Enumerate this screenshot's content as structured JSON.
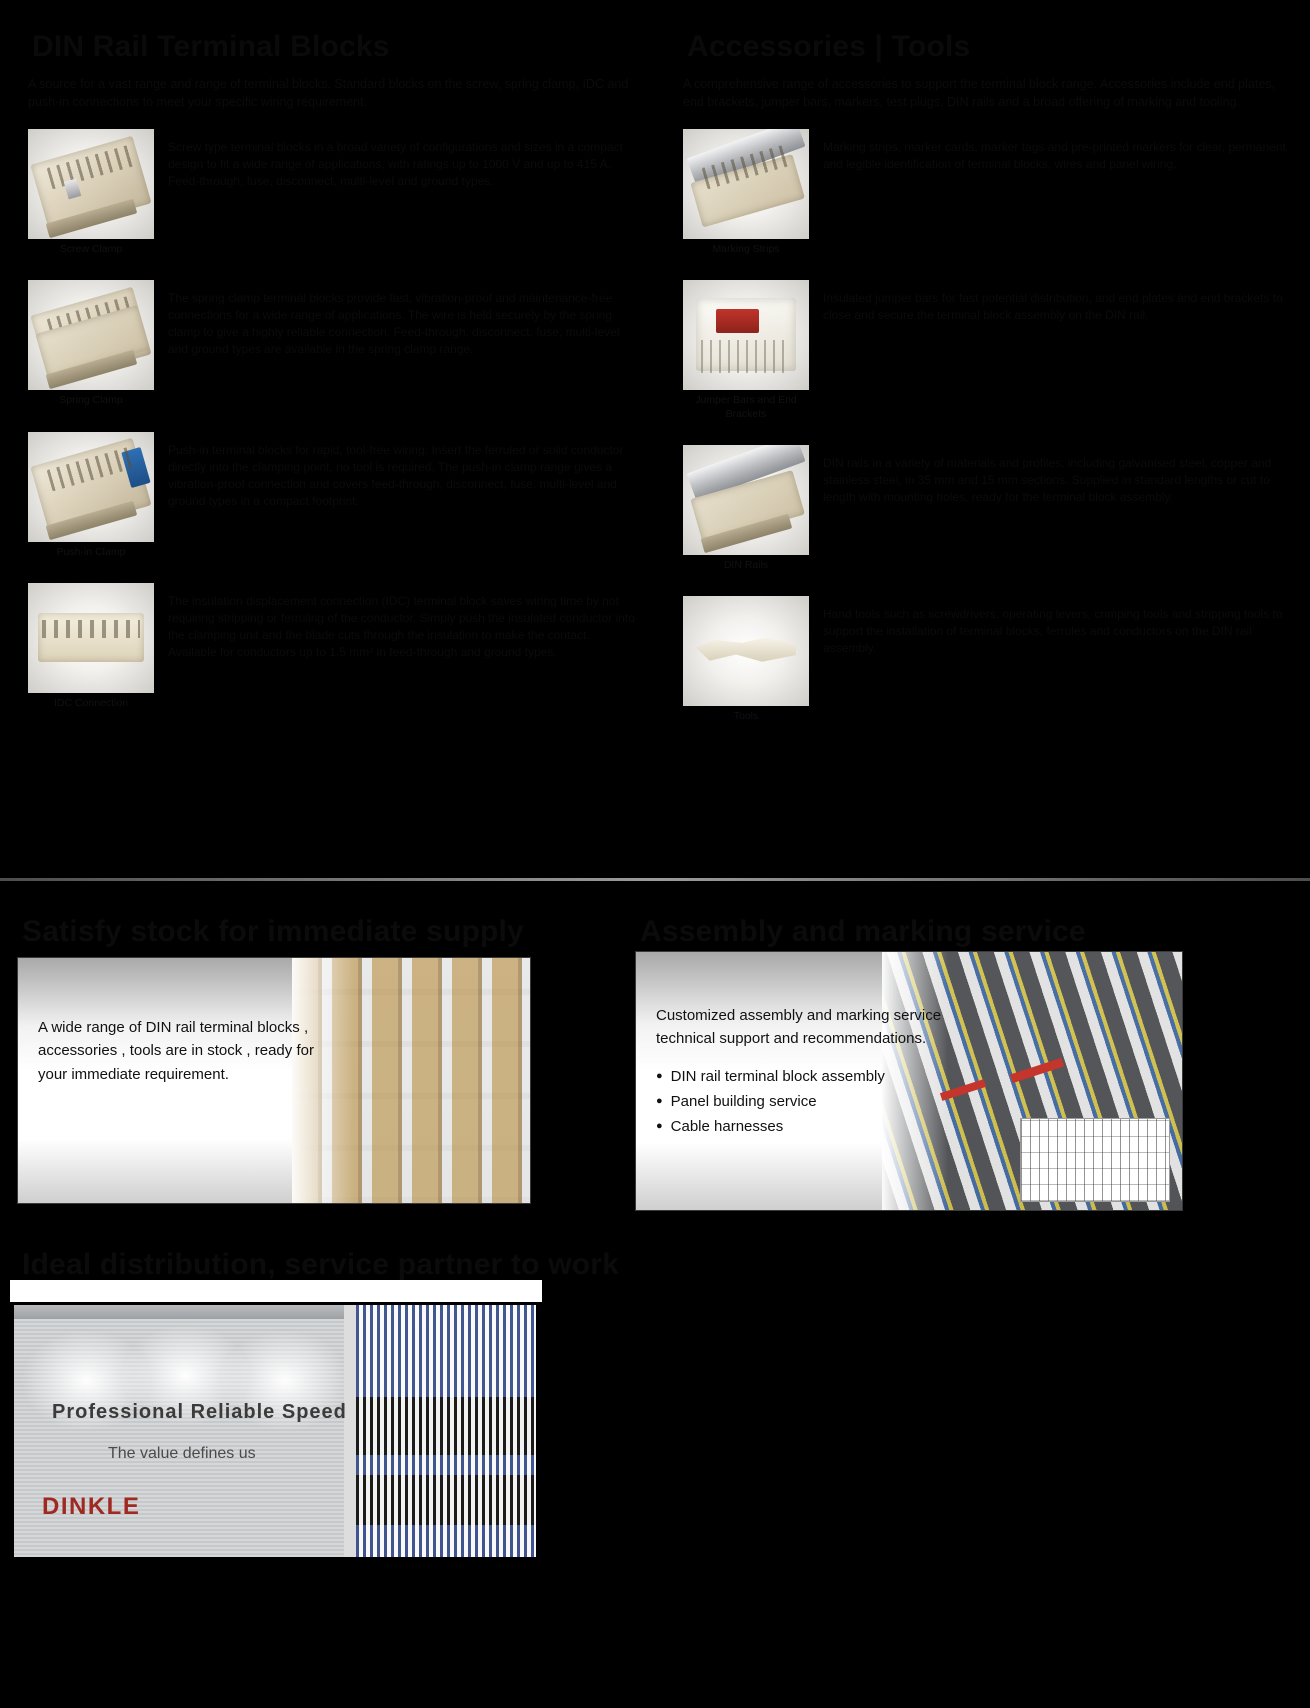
{
  "meta": {
    "background": "#000000",
    "accent_red": "#a02a22"
  },
  "left_column": {
    "heading": "DIN Rail Terminal Blocks",
    "intro": "A source for a vast range and range of terminal blocks. Standard blocks on the screw, spring clamp, IDC and push-in connections to meet your specific wiring requirement.",
    "items": [
      {
        "caption": "Screw Clamp",
        "text": "Screw type terminal blocks in a broad variety of configurations and sizes in a compact design to fit a wide range of applications, with ratings up to 1000 V and up to 415 A. Feed-through, fuse, disconnect, multi-level and ground types.",
        "icon": "terminal-block-screw-clamp"
      },
      {
        "caption": "Spring Clamp",
        "text": "The spring clamp terminal blocks provide fast, vibration-proof and maintenance-free connections for a wide range of applications. The wire is held securely by the spring clamp to give a highly reliable connection. Feed-through, disconnect, fuse, multi-level and ground types are available in the spring clamp range.",
        "icon": "terminal-block-spring-clamp"
      },
      {
        "caption": "Push-in Clamp",
        "text": "Push-in terminal blocks for rapid, tool-free wiring. Insert the ferruled or solid conductor directly into the clamping point, no tool is required. The push-in clamp range gives a vibration-proof connection and covers feed-through, disconnect, fuse, multi-level and ground types in a compact footprint.",
        "icon": "terminal-block-push-in"
      },
      {
        "caption": "IDC Connection",
        "text": "The insulation displacement connection (IDC) terminal block saves wiring time by not requiring stripping or ferruling of the conductor. Simply push the insulated conductor into the clamping unit and the blade cuts through the insulation to make the contact. Available for conductors up to 1.5 mm² in feed-through and ground types.",
        "icon": "terminal-block-idc"
      }
    ]
  },
  "right_column": {
    "heading": "Accessories | Tools",
    "intro": "A comprehensive range of accessories to support the terminal block range. Accessories include end plates, end brackets, jumper bars, markers, test plugs, DIN rails and a broad offering of marking and tooling.",
    "items": [
      {
        "caption": "Marking Strips",
        "text": "Marking strips, marker cards, marker tags and pre-printed markers for clear, permanent and legible identification of terminal blocks, wires and panel wiring.",
        "icon": "marking-strips"
      },
      {
        "caption": "Jumper Bars and End\nBrackets",
        "text": "Insulated jumper bars for fast potential distribution, and end plates and end brackets to close and secure the terminal block assembly on the DIN rail.",
        "icon": "jumper-bars-end-brackets"
      },
      {
        "caption": "DIN Rails",
        "text": "DIN rails in a variety of materials and profiles, including galvanised steel, copper and stainless steel, in 35 mm and 15 mm sections. Supplied in standard lengths or cut to length with mounting holes, ready for the terminal block assembly.",
        "icon": "din-rails"
      },
      {
        "caption": "Tools",
        "text": "Hand tools such as screwdrivers, operating levers, crimping tools and stripping tools to support the installation of terminal blocks, ferrules and conductors on the DIN rail assembly.",
        "icon": "hand-tools"
      }
    ]
  },
  "panels": {
    "stock": {
      "heading": "Satisfy stock for immediate supply",
      "body": "A wide range of DIN rail terminal blocks , accessories , tools are in stock , ready for your immediate requirement.",
      "image": "warehouse-racking-photo"
    },
    "assembly": {
      "heading": "Assembly and marking service",
      "body": "Customized assembly and marking service technical support and recommendations.",
      "bullets": [
        "DIN rail terminal block assembly",
        "Panel building service",
        "Cable harnesses"
      ],
      "image": "assembled-terminal-blocks-photo"
    },
    "distribution": {
      "heading": "Ideal distribution, service partner to work",
      "banner": {
        "title": "Professional  Reliable  Speed",
        "subtitle": "The value defines us",
        "logo": "DINKLE",
        "image": "control-panel-wiring-photo"
      }
    }
  }
}
